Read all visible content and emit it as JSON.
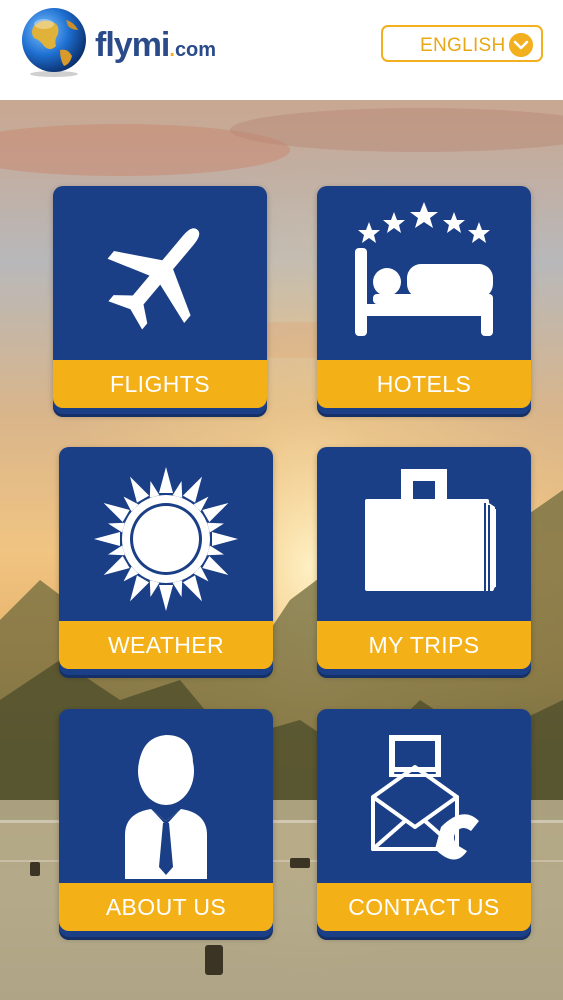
{
  "header": {
    "brand": {
      "name_fly": "fly",
      "name_mi": "mi",
      "dot": ".",
      "tld": "com"
    },
    "language": {
      "label": "ENGLISH",
      "icon": "chevron-down-icon"
    }
  },
  "tiles": [
    {
      "key": "flights",
      "label": "FLIGHTS",
      "icon": "airplane-icon"
    },
    {
      "key": "hotels",
      "label": "HOTELS",
      "icon": "hotel-bed-icon"
    },
    {
      "key": "weather",
      "label": "WEATHER",
      "icon": "sun-icon"
    },
    {
      "key": "mytrips",
      "label": "MY TRIPS",
      "icon": "briefcase-icon"
    },
    {
      "key": "about",
      "label": "ABOUT US",
      "icon": "businessman-icon"
    },
    {
      "key": "contact",
      "label": "CONTACT US",
      "icon": "contact-mail-phone-icon"
    }
  ],
  "colors": {
    "tile_blue": "#1b3f86",
    "accent_yellow": "#f4b117",
    "brand_blue": "#2a4a8a"
  }
}
